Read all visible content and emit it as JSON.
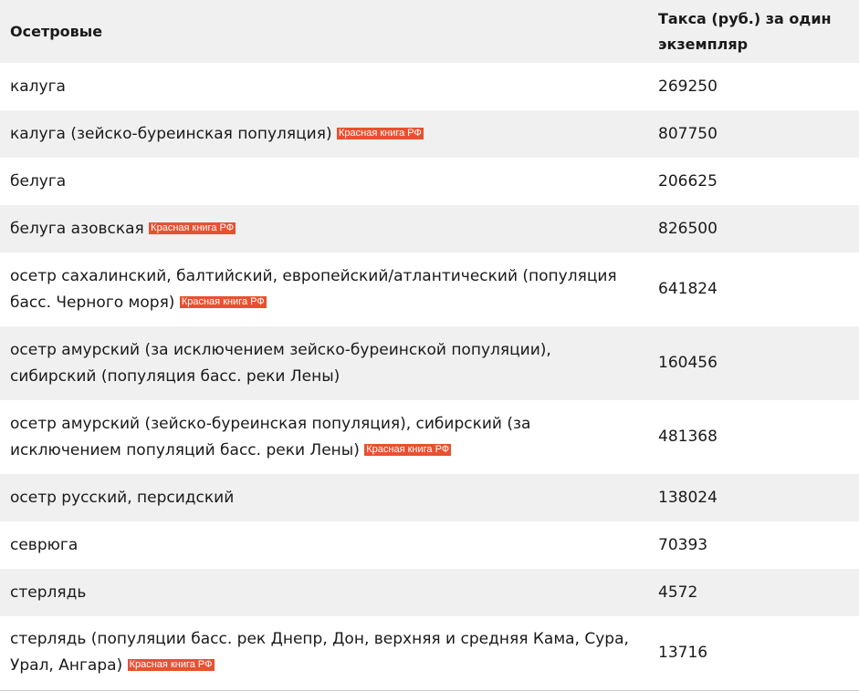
{
  "table": {
    "header": {
      "species": "Осетровые",
      "price": "Такса (руб.) за один экземпляр"
    },
    "badge_label": "Красная книга РФ",
    "badge_color": "#e8512f",
    "rows": [
      {
        "name": "калуга",
        "red_book": false,
        "price": "269250"
      },
      {
        "name": "калуга (зейско-буреинская популяция)",
        "red_book": true,
        "price": "807750"
      },
      {
        "name": "белуга",
        "red_book": false,
        "price": "206625"
      },
      {
        "name": "белуга азовская",
        "red_book": true,
        "price": "826500"
      },
      {
        "name": "осетр сахалинский, балтийский, европейский/атлантический (популяция басс. Черного моря)",
        "red_book": true,
        "price": "641824"
      },
      {
        "name": "осетр амурский (за исключением зейско-буреинской популяции), сибирский (популяция басс. реки Лены)",
        "red_book": false,
        "price": "160456"
      },
      {
        "name": "осетр амурский (зейско-буреинская популяция), сибирский (за исключением популяций басс. реки Лены)",
        "red_book": true,
        "price": "481368"
      },
      {
        "name": "осетр русский, персидский",
        "red_book": false,
        "price": "138024"
      },
      {
        "name": "севрюга",
        "red_book": false,
        "price": "70393"
      },
      {
        "name": "стерлядь",
        "red_book": false,
        "price": "4572"
      },
      {
        "name": "стерлядь (популяции басс. рек Днепр, Дон, верхняя и средняя Кама, Сура, Урал, Ангара)",
        "red_book": true,
        "price": "13716"
      }
    ]
  }
}
